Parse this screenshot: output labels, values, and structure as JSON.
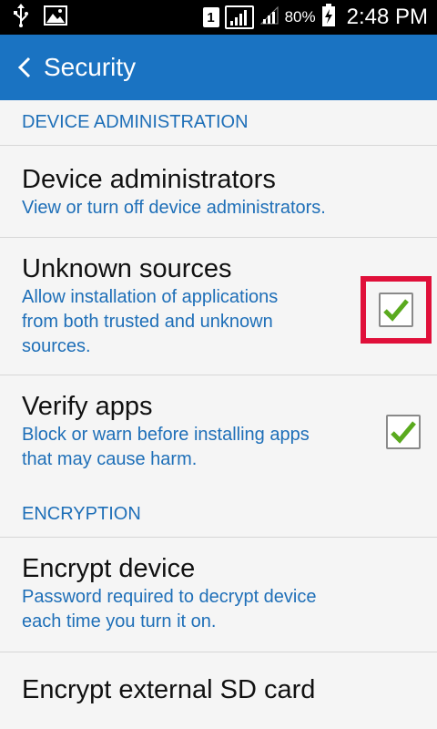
{
  "status_bar": {
    "sim_slot": "1",
    "battery": "80%",
    "time": "2:48 PM"
  },
  "header": {
    "title": "Security"
  },
  "sections": {
    "device_admin": "DEVICE ADMINISTRATION",
    "encryption": "ENCRYPTION"
  },
  "items": {
    "device_administrators": {
      "title": "Device administrators",
      "subtitle": "View or turn off device administrators."
    },
    "unknown_sources": {
      "title": "Unknown sources",
      "subtitle_line1": "Allow installation of applications",
      "subtitle_line2": "from both trusted and unknown",
      "subtitle_line3": "sources.",
      "checked": true
    },
    "verify_apps": {
      "title": "Verify apps",
      "subtitle_line1": "Block or warn before installing apps",
      "subtitle_line2": "that may cause harm.",
      "checked": true
    },
    "encrypt_device": {
      "title": "Encrypt device",
      "subtitle_line1": "Password required to decrypt device",
      "subtitle_line2": "each time you turn it on."
    },
    "encrypt_sd": {
      "title": "Encrypt external SD card"
    }
  },
  "colors": {
    "header_bg": "#1a73c2",
    "accent_text": "#1e6fb8",
    "check_green": "#5aaa1e",
    "highlight": "#e0103a"
  }
}
